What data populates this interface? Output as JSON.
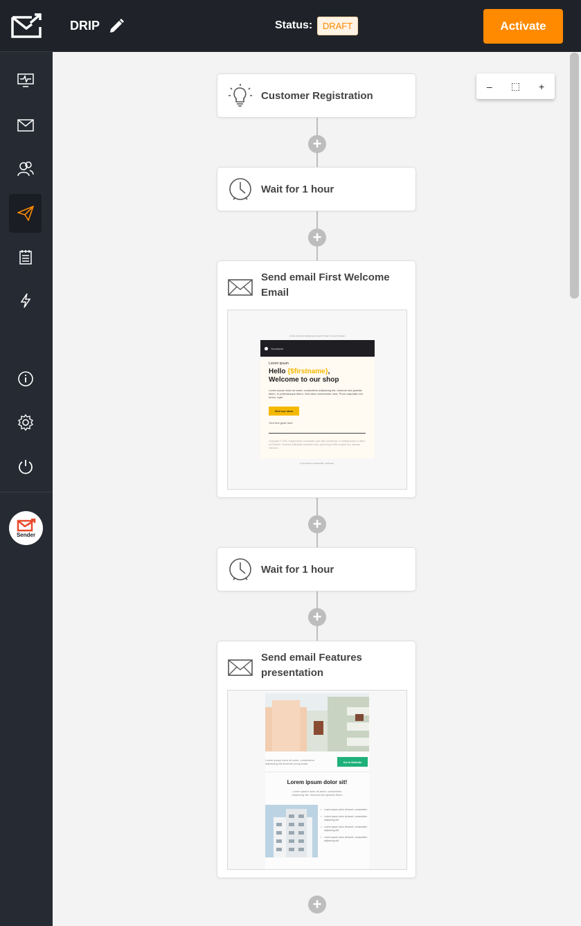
{
  "app": {
    "title": "DRIP",
    "status_label": "Status:",
    "status_value": "DRAFT",
    "activate_label": "Activate",
    "brand_color": "#ff8a00",
    "sidebar_items": [
      {
        "name": "dashboard-icon"
      },
      {
        "name": "campaigns-icon"
      },
      {
        "name": "subscribers-icon"
      },
      {
        "name": "automation-icon",
        "active": true
      },
      {
        "name": "forms-icon"
      },
      {
        "name": "flash-icon"
      },
      {
        "name": "info-icon"
      },
      {
        "name": "settings-icon"
      },
      {
        "name": "power-icon"
      }
    ],
    "sender_badge": "Sender"
  },
  "zoom": {
    "minus": "–",
    "fit": "⬚",
    "plus": "+"
  },
  "workflow": {
    "plus_label": "+",
    "steps": [
      {
        "type": "trigger",
        "label": "Customer Registration"
      },
      {
        "type": "wait",
        "label": "Wait for 1 hour"
      },
      {
        "type": "email",
        "label": "Send email First Welcome Email"
      },
      {
        "type": "wait",
        "label": "Wait for 1 hour"
      },
      {
        "type": "email",
        "label": "Send email Features presentation"
      }
    ]
  },
  "preview1": {
    "top_text": "Is this email not displaying correctly? View it in your browser",
    "brand": "Yourname",
    "lorem": "Lorem ipsum",
    "hello": "Hello",
    "firstname": "{$firstname}",
    "welcome": "Welcome to our shop",
    "body": "Lorem ipsum dolor sit amet, consectetur adipiscing elit, donecat sed gravida libero, in pellentesque libero. Sed vitae consectetur uma. Proin vulputate orci lorem, eget",
    "button": "Visit our store",
    "signature": "Your text goes here",
    "footer": "Copyright © 2021 Suspendisse consectetur quis nibh vinetemas. In habitat auctor in libero sed blandit. Vivamus sollicitudin tincidunt nulla, quis tempor felis suscipit nec, aenean interdum.",
    "bottom_text": "If you want to unsubscribe, click here."
  },
  "preview2": {
    "text": "Lorem ipsum dolor sit amet, consectetur adipiscing elit donecat sed gravida",
    "button": "Go to Website",
    "heading": "Lorem ipsum dolor sit!",
    "sub": "Lorem ipsum dolor sit amet, consectetur adipiscing elit, donecat sed gravida libero",
    "list": [
      "Lorem ipsum dolor sit amet, consectetur",
      "Lorem ipsum dolor sit amet, consectetur adipiscing elit",
      "Lorem ipsum dolor sit amet, consectetur adipiscing elit",
      "Lorem ipsum dolor sit amet, consectetur adipiscing elit"
    ]
  }
}
